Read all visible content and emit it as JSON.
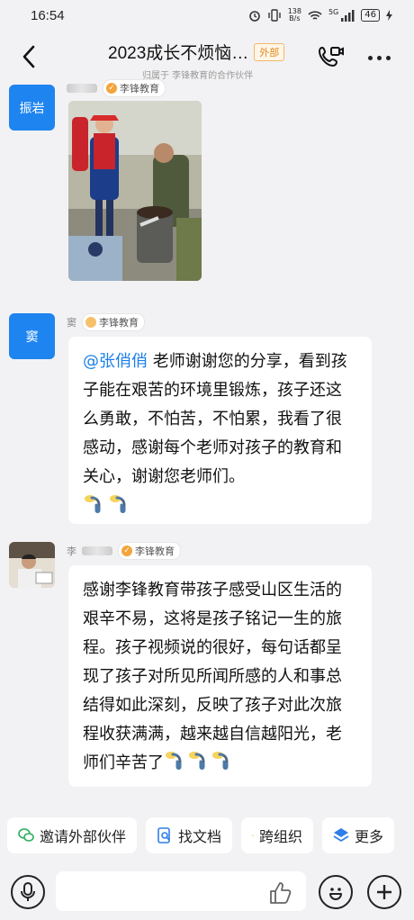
{
  "status_bar": {
    "time": "16:54",
    "net_speed_value": "138",
    "net_speed_unit": "B/s",
    "signal_label": "5G",
    "battery": "46"
  },
  "header": {
    "title": "2023成长不烦恼…",
    "badge": "外部",
    "subtitle": "归属于 李锋教育的合作伙伴"
  },
  "messages": [
    {
      "avatar_text": "振岩",
      "sender_name_visible": "振岩",
      "org": "李锋教育",
      "type": "image"
    },
    {
      "avatar_text": "窦",
      "sender_name_visible": "窦",
      "org": "李锋教育",
      "type": "text",
      "mention": "@张俏俏",
      "text": " 老师谢谢您的分享，看到孩子能在艰苦的环境里锻炼，孩子还这么勇敢，不怕苦，不怕累，我看了很感动，感谢每个老师对孩子的教育和关心，谢谢您老师们。",
      "emoji_count": 2
    },
    {
      "avatar_text": "",
      "sender_name_visible": "李",
      "org": "李锋教育",
      "type": "text",
      "text": "感谢李锋教育带孩子感受山区生活的艰辛不易，这将是孩子铭记一生的旅程。孩子视频说的很好，每句话都呈现了孩子对所见所闻所感的人和事总结得如此深刻，反映了孩子对此次旅程收获满满，越来越自信越阳光，老师们辛苦了",
      "emoji_count": 3
    }
  ],
  "quick_actions": [
    {
      "label": "邀请外部伙伴",
      "icon": "wechat-icon",
      "color": "#2bae5c"
    },
    {
      "label": "找文档",
      "icon": "doc-search-icon",
      "color": "#2f7ee8"
    },
    {
      "label": "跨组织",
      "icon": "person-icon",
      "color": "#e49a2a"
    },
    {
      "label": "更多",
      "icon": "more-apps-icon",
      "color": "#2f7ee8"
    }
  ],
  "input": {
    "placeholder": ""
  },
  "colors": {
    "accent_blue": "#1e84f0",
    "mention_blue": "#1c7fe8",
    "badge_orange": "#e08a1e"
  }
}
